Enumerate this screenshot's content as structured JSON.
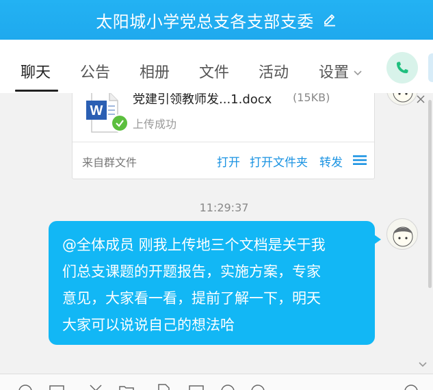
{
  "window": {
    "title": "太阳城小学党总支各支部支委"
  },
  "tabs": [
    {
      "label": "聊天"
    },
    {
      "label": "公告"
    },
    {
      "label": "相册"
    },
    {
      "label": "文件"
    },
    {
      "label": "活动"
    },
    {
      "label": "设置"
    }
  ],
  "file_message": {
    "file_name": "党建引领教师发...1.docx",
    "file_size": "(15KB)",
    "status": "上传成功",
    "source": "来自群文件",
    "actions": [
      "打开",
      "打开文件夹",
      "转发"
    ]
  },
  "timestamp": "11:29:37",
  "text_message": {
    "lines": [
      "@全体成员 刚我上传地三个文档是关于我",
      "们总支课题的开题报告，实施方案，专家",
      "意见，大家看一看，提前了解一下，明天",
      "大家可以说说自己的想法哈"
    ]
  },
  "colors": {
    "title_bar": "#1fa9ee",
    "bubble": "#12b7f5",
    "link": "#1a93e2",
    "success": "#5cbf3e",
    "phone": "#1fbf7e"
  },
  "icons": [
    "edit-icon",
    "chevron-down-icon",
    "phone-icon",
    "word-doc-icon",
    "check-icon",
    "menu-icon",
    "close-icon",
    "avatar"
  ]
}
